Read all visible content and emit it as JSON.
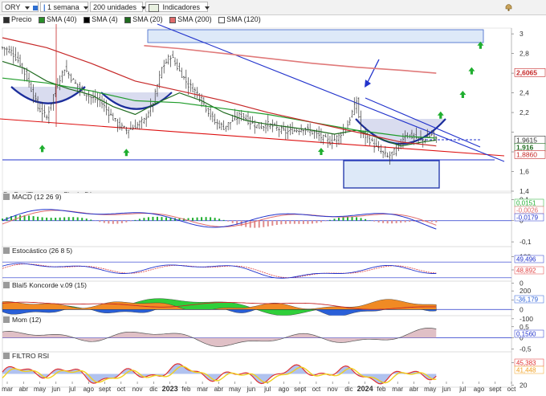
{
  "toolbar": {
    "symbol": "ORY",
    "period": "1 semana",
    "units": "200 unidades",
    "indicators_label": "Indicadores",
    "legend": [
      {
        "label": "Precio",
        "color": "#2d2d2d"
      },
      {
        "label": "SMA (40)",
        "color": "#2a8f2a"
      },
      {
        "label": "SMA (4)",
        "color": "#000000"
      },
      {
        "label": "SMA (20)",
        "color": "#1f6b1f"
      },
      {
        "label": "SMA (200)",
        "color": "#e06b6b"
      },
      {
        "label": "SMA (120)",
        "color": "#ffffff"
      }
    ]
  },
  "source_label": "ProRealTime.com - Fin de Día",
  "chart_data": [
    {
      "type": "line",
      "title": "",
      "x_tick_labels": [
        "mar",
        "abr",
        "may",
        "jun",
        "jul",
        "ago",
        "sept",
        "oct",
        "nov",
        "dic",
        "2023",
        "feb",
        "mar",
        "abr",
        "may",
        "jun",
        "jul",
        "ago",
        "sept",
        "oct",
        "nov",
        "dic",
        "2024",
        "feb",
        "mar",
        "abr",
        "may",
        "jun",
        "jul",
        "ago",
        "sept",
        "oct"
      ],
      "y_ticks": [
        1.4,
        1.6,
        1.8,
        2.0,
        2.2,
        2.4,
        2.6,
        2.8,
        3.0
      ],
      "y_tick_labels": [
        "1,4",
        "1,6",
        "1,8",
        "",
        "2,2",
        "2,4",
        "",
        "2,8",
        "3"
      ],
      "ylim": [
        1.4,
        3.05
      ],
      "price_labels": [
        {
          "value": 2.6065,
          "text": "2,6065",
          "color": "#c62828",
          "bold": true
        },
        {
          "value": 1.92,
          "text": "1,9615",
          "color": "#2d2d2d"
        },
        {
          "value": 1.878,
          "text": "1,916",
          "color": "#1f6b1f",
          "bold": true
        },
        {
          "value": 1.84,
          "text": "1,8860",
          "color": "#c62828"
        }
      ],
      "series": [
        {
          "name": "Precio",
          "color": "#2d2d2d",
          "points": [
            [
              0,
              2.86
            ],
            [
              4,
              2.82
            ],
            [
              8,
              2.7
            ],
            [
              12,
              2.5
            ],
            [
              16,
              2.25
            ],
            [
              20,
              2.15
            ],
            [
              24,
              2.45
            ],
            [
              28,
              2.65
            ],
            [
              32,
              2.52
            ],
            [
              36,
              2.42
            ],
            [
              40,
              2.35
            ],
            [
              44,
              2.32
            ],
            [
              48,
              2.2
            ],
            [
              52,
              2.08
            ],
            [
              56,
              2.02
            ],
            [
              60,
              2.06
            ],
            [
              64,
              2.12
            ],
            [
              68,
              2.3
            ],
            [
              72,
              2.65
            ],
            [
              76,
              2.78
            ],
            [
              80,
              2.62
            ],
            [
              84,
              2.48
            ],
            [
              88,
              2.4
            ],
            [
              92,
              2.25
            ],
            [
              96,
              2.1
            ],
            [
              100,
              2.05
            ],
            [
              104,
              2.12
            ],
            [
              108,
              2.18
            ],
            [
              112,
              2.1
            ],
            [
              116,
              2.05
            ],
            [
              120,
              2.08
            ],
            [
              124,
              2.04
            ],
            [
              128,
              2.0
            ],
            [
              132,
              2.02
            ],
            [
              136,
              2.04
            ],
            [
              140,
              2.0
            ],
            [
              144,
              1.95
            ],
            [
              148,
              1.9
            ],
            [
              152,
              1.96
            ],
            [
              156,
              2.08
            ],
            [
              160,
              2.32
            ],
            [
              162,
              2.0
            ],
            [
              166,
              1.92
            ],
            [
              170,
              1.82
            ],
            [
              174,
              1.75
            ],
            [
              178,
              1.82
            ],
            [
              182,
              1.98
            ],
            [
              186,
              1.95
            ],
            [
              190,
              1.92
            ],
            [
              194,
              1.98
            ],
            [
              196,
              1.92
            ]
          ]
        },
        {
          "name": "SMA (20)",
          "color": "#1f6b1f",
          "points": [
            [
              0,
              2.72
            ],
            [
              10,
              2.65
            ],
            [
              20,
              2.52
            ],
            [
              30,
              2.44
            ],
            [
              40,
              2.38
            ],
            [
              50,
              2.26
            ],
            [
              60,
              2.18
            ],
            [
              70,
              2.3
            ],
            [
              80,
              2.4
            ],
            [
              90,
              2.32
            ],
            [
              100,
              2.2
            ],
            [
              110,
              2.12
            ],
            [
              120,
              2.08
            ],
            [
              130,
              2.05
            ],
            [
              140,
              2.02
            ],
            [
              150,
              1.98
            ],
            [
              160,
              2.02
            ],
            [
              170,
              1.94
            ],
            [
              180,
              1.86
            ],
            [
              190,
              1.9
            ],
            [
              196,
              1.92
            ]
          ]
        },
        {
          "name": "SMA (40)",
          "color": "#1f9c2a",
          "points": [
            [
              0,
              2.55
            ],
            [
              20,
              2.5
            ],
            [
              40,
              2.42
            ],
            [
              60,
              2.32
            ],
            [
              80,
              2.3
            ],
            [
              100,
              2.24
            ],
            [
              120,
              2.18
            ],
            [
              140,
              2.1
            ],
            [
              160,
              2.02
            ],
            [
              180,
              1.96
            ],
            [
              196,
              1.94
            ]
          ]
        },
        {
          "name": "SMA (120)",
          "color": "#c62828",
          "points": [
            [
              0,
              2.96
            ],
            [
              20,
              2.86
            ],
            [
              40,
              2.7
            ],
            [
              60,
              2.52
            ],
            [
              80,
              2.42
            ],
            [
              100,
              2.32
            ],
            [
              120,
              2.2
            ],
            [
              140,
              2.1
            ],
            [
              160,
              2.0
            ],
            [
              180,
              1.9
            ],
            [
              196,
              1.86
            ]
          ]
        },
        {
          "name": "SMA (200)",
          "color": "#e07a7a",
          "points": [
            [
              64,
              2.88
            ],
            [
              80,
              2.85
            ],
            [
              100,
              2.8
            ],
            [
              120,
              2.75
            ],
            [
              140,
              2.7
            ],
            [
              160,
              2.66
            ],
            [
              180,
              2.63
            ],
            [
              196,
              2.6
            ]
          ]
        }
      ],
      "markers": {
        "up_arrows": [
          [
            18,
            1.83
          ],
          [
            56,
            1.79
          ],
          [
            144,
            1.8
          ],
          [
            198,
            2.17
          ],
          [
            208,
            2.38
          ],
          [
            212,
            2.62
          ],
          [
            216,
            2.88
          ]
        ]
      }
    },
    {
      "type": "bar",
      "title": "MACD (12 26 9)",
      "ylim": [
        -0.13,
        0.09
      ],
      "y_tick_labels": [
        "0,1",
        "0",
        "-0,1"
      ],
      "y_ticks": [
        0.1,
        0,
        -0.1
      ],
      "value_labels": [
        "0,0151",
        "-0,0026",
        "-0,0179"
      ]
    },
    {
      "type": "line",
      "title": "Estocástico (26 8 5)",
      "ylim": [
        -5,
        105
      ],
      "y_tick_labels": [
        "100",
        "50",
        "0"
      ],
      "y_ticks": [
        100,
        50,
        0
      ],
      "value_labels": [
        "49,496",
        "48,892"
      ]
    },
    {
      "type": "area",
      "title": "Blai5 Koncorde v.09 (15)",
      "ylim": [
        -110,
        210
      ],
      "y_tick_labels": [
        "200",
        "100",
        "0",
        "-100"
      ],
      "y_ticks": [
        200,
        100,
        0,
        -100
      ],
      "value_labels": [
        "-36,179"
      ]
    },
    {
      "type": "area",
      "title": "Mom (12)",
      "ylim": [
        -0.7,
        0.6
      ],
      "y_tick_labels": [
        "0,5",
        "0",
        "-0,5"
      ],
      "y_ticks": [
        0.5,
        0,
        -0.5
      ],
      "value_labels": [
        "0,1560"
      ]
    },
    {
      "type": "line",
      "title": "FILTRO RSI",
      "ylim": [
        15,
        85
      ],
      "y_tick_labels": [
        "80",
        "20"
      ],
      "y_ticks": [
        80,
        20
      ],
      "value_labels": [
        "45,383",
        "41,448"
      ]
    }
  ]
}
